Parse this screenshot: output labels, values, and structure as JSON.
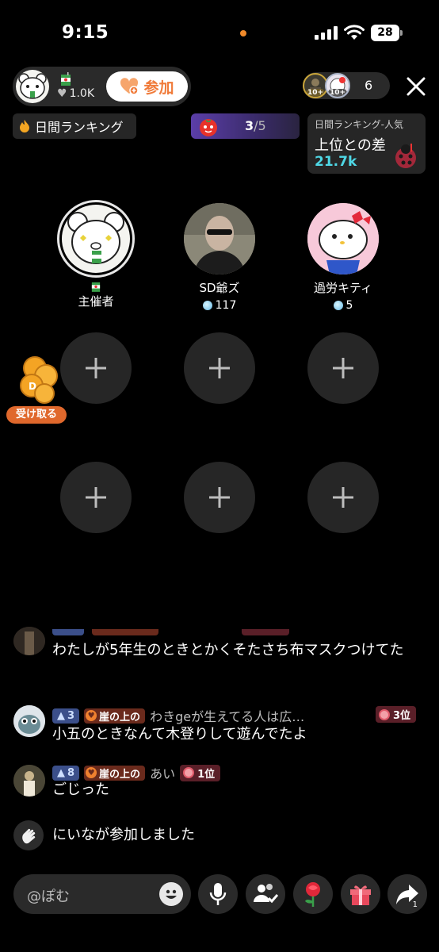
{
  "status": {
    "time": "9:15",
    "battery": "28"
  },
  "host": {
    "likes": "1.0K",
    "join_label": "参加"
  },
  "viewers": {
    "badge1": "10+",
    "badge2": "10+",
    "count": "6"
  },
  "ranking": {
    "label": "日間ランキング",
    "progress_current": "3",
    "progress_total": "/5"
  },
  "gap_card": {
    "label": "日間ランキング-人気",
    "title": "上位との差",
    "value": "21.7k"
  },
  "guests": [
    {
      "name": "主催者",
      "score": ""
    },
    {
      "name": "SD爺ズ",
      "score": "117"
    },
    {
      "name": "過労キティ",
      "score": "5"
    }
  ],
  "reward": {
    "claim_label": "受け取る"
  },
  "chat": [
    {
      "text": "わたしが5年生のときとかくそたさち布マスクつけてた"
    },
    {
      "level": "3",
      "fan": "崖の上の",
      "user": "わきgeが生えてる人は広…",
      "rank": "3位",
      "text": "小五のときなんて木登りして遊んでたよ"
    },
    {
      "level": "8",
      "fan": "崖の上の",
      "user": "あい",
      "rank": "1位",
      "text": "ごじった"
    },
    {
      "text": "にいなが参加しました"
    }
  ],
  "composer": {
    "placeholder": "@ぽむ",
    "share_count": "1"
  },
  "colors": {
    "accent": "#f07b3a",
    "cyan": "#4fd8e6",
    "slot": "#262626"
  }
}
